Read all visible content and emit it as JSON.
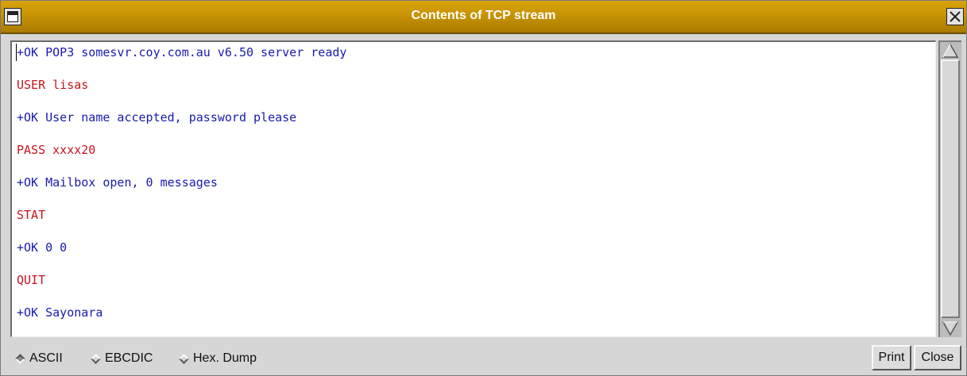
{
  "window": {
    "title": "Contents of TCP stream"
  },
  "stream": {
    "lines": [
      {
        "text": "+OK POP3 somesvr.coy.com.au v6.50 server ready",
        "color": "#1a1ab0"
      },
      {
        "text": "USER lisas",
        "color": "#c8141e"
      },
      {
        "text": "+OK User name accepted, password please",
        "color": "#1a1ab0"
      },
      {
        "text": "PASS xxxx20",
        "color": "#c8141e"
      },
      {
        "text": "+OK Mailbox open, 0 messages",
        "color": "#1a1ab0"
      },
      {
        "text": "STAT",
        "color": "#c8141e"
      },
      {
        "text": "+OK 0 0",
        "color": "#1a1ab0"
      },
      {
        "text": "QUIT",
        "color": "#c8141e"
      },
      {
        "text": "+OK Sayonara",
        "color": "#1a1ab0"
      }
    ]
  },
  "format_options": {
    "ascii": "ASCII",
    "ebcdic": "EBCDIC",
    "hex_dump": "Hex. Dump",
    "selected": "ASCII"
  },
  "buttons": {
    "print": "Print",
    "close": "Close"
  },
  "colors": {
    "client": "#c8141e",
    "server": "#1a1ab0",
    "titlebar": "#c89304"
  }
}
